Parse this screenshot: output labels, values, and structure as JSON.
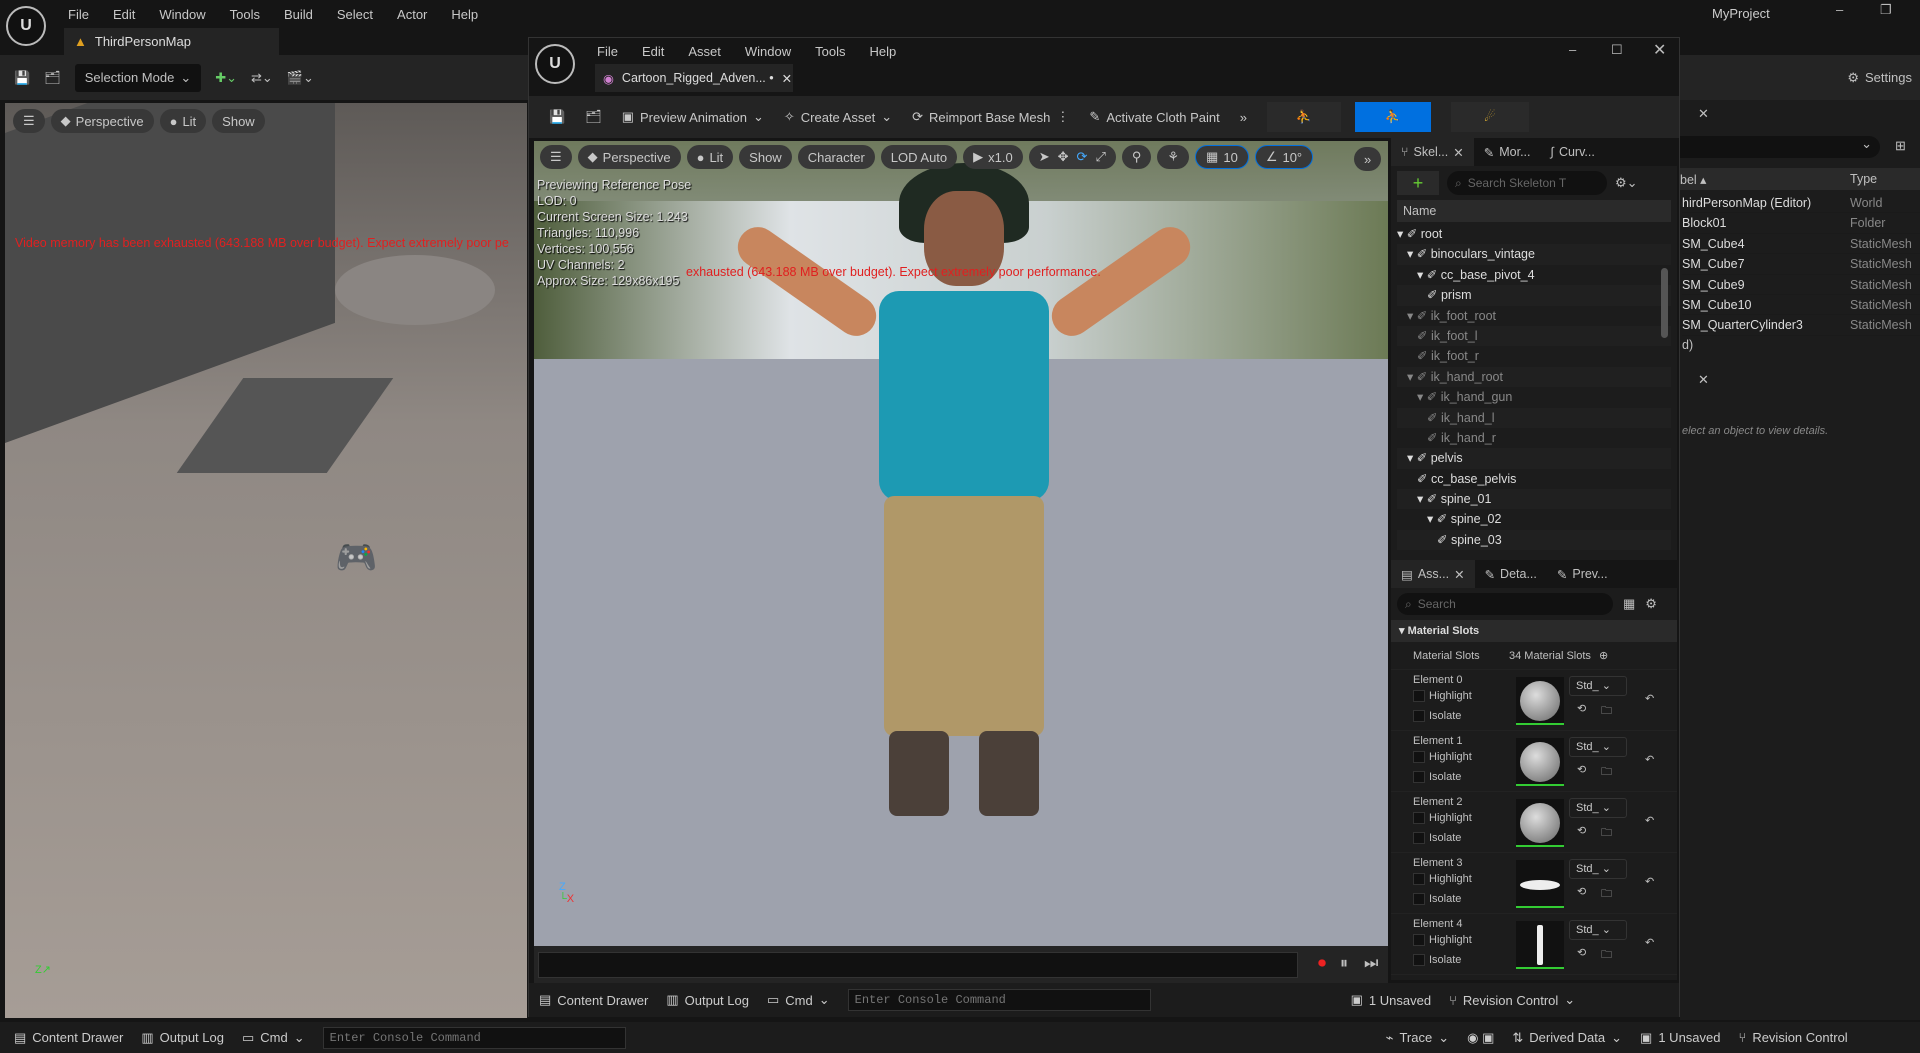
{
  "main": {
    "menu": [
      "File",
      "Edit",
      "Window",
      "Tools",
      "Build",
      "Select",
      "Actor",
      "Help"
    ],
    "project": "MyProject",
    "tab": "ThirdPersonMap",
    "selection_mode": "Selection Mode",
    "settings": "Settings"
  },
  "left_viewport": {
    "perspective": "Perspective",
    "lit": "Lit",
    "show": "Show",
    "warning": "Video memory has been exhausted (643.188 MB over budget). Expect extremely poor pe"
  },
  "asset_editor": {
    "menu": [
      "File",
      "Edit",
      "Asset",
      "Window",
      "Tools",
      "Help"
    ],
    "tab": "Cartoon_Rigged_Adven... •",
    "toolbar": {
      "preview_animation": "Preview Animation",
      "create_asset": "Create Asset",
      "reimport": "Reimport Base Mesh",
      "cloth_paint": "Activate Cloth Paint"
    },
    "viewport": {
      "perspective": "Perspective",
      "lit": "Lit",
      "show": "Show",
      "character": "Character",
      "lod": "LOD Auto",
      "speed": "x1.0",
      "grid": "10",
      "angle": "10°",
      "stats": [
        "Previewing Reference Pose",
        "LOD: 0",
        "Current Screen Size: 1.243",
        "Triangles: 110,996",
        "Vertices: 100,556",
        "UV Channels: 2",
        "Approx Size: 129x86x195"
      ],
      "warning": "exhausted (643.188 MB over budget). Expect extremely poor performance."
    },
    "status": {
      "content_drawer": "Content Drawer",
      "output_log": "Output Log",
      "cmd": "Cmd",
      "console_placeholder": "Enter Console Command",
      "unsaved": "1 Unsaved",
      "revision": "Revision Control"
    },
    "skeleton": {
      "tabs": [
        "Skel...",
        "Mor...",
        "Curv..."
      ],
      "search_placeholder": "Search Skeleton T",
      "column": "Name",
      "bones": [
        {
          "name": "root",
          "d": 0
        },
        {
          "name": "binoculars_vintage",
          "d": 1
        },
        {
          "name": "cc_base_pivot_4",
          "d": 2
        },
        {
          "name": "prism",
          "d": 3
        },
        {
          "name": "ik_foot_root",
          "d": 1,
          "dim": true
        },
        {
          "name": "ik_foot_l",
          "d": 2,
          "dim": true
        },
        {
          "name": "ik_foot_r",
          "d": 2,
          "dim": true
        },
        {
          "name": "ik_hand_root",
          "d": 1,
          "dim": true
        },
        {
          "name": "ik_hand_gun",
          "d": 2,
          "dim": true
        },
        {
          "name": "ik_hand_l",
          "d": 3,
          "dim": true
        },
        {
          "name": "ik_hand_r",
          "d": 3,
          "dim": true
        },
        {
          "name": "pelvis",
          "d": 1
        },
        {
          "name": "cc_base_pelvis",
          "d": 2
        },
        {
          "name": "spine_01",
          "d": 2
        },
        {
          "name": "spine_02",
          "d": 3
        },
        {
          "name": "spine_03",
          "d": 4
        }
      ]
    },
    "details": {
      "tabs": [
        "Ass...",
        "Deta...",
        "Prev..."
      ],
      "search_placeholder": "Search",
      "section": "Material Slots",
      "slots_label": "Material Slots",
      "slots_count": "34 Material Slots",
      "highlight": "Highlight",
      "isolate": "Isolate",
      "std": "Std_",
      "elements": [
        "Element 0",
        "Element 1",
        "Element 2",
        "Element 3",
        "Element 4"
      ]
    }
  },
  "outliner": {
    "col_label": "bel ▴",
    "col_type": "Type",
    "rows": [
      [
        "hirdPersonMap (Editor)",
        "World"
      ],
      [
        "Block01",
        "Folder"
      ],
      [
        "SM_Cube4",
        "StaticMesh"
      ],
      [
        "SM_Cube7",
        "StaticMesh"
      ],
      [
        "SM_Cube9",
        "StaticMesh"
      ],
      [
        "SM_Cube10",
        "StaticMesh"
      ],
      [
        "SM_QuarterCylinder3",
        "StaticMesh"
      ]
    ],
    "footer": "d)",
    "details_hint": "elect an object to view details."
  },
  "footer": {
    "content_drawer": "Content Drawer",
    "output_log": "Output Log",
    "cmd": "Cmd",
    "console_placeholder": "Enter Console Command",
    "trace": "Trace",
    "derived_data": "Derived Data",
    "unsaved": "1 Unsaved",
    "revision": "Revision Control"
  },
  "colors": {
    "accent": "#0070e0",
    "warning": "#e02020"
  }
}
